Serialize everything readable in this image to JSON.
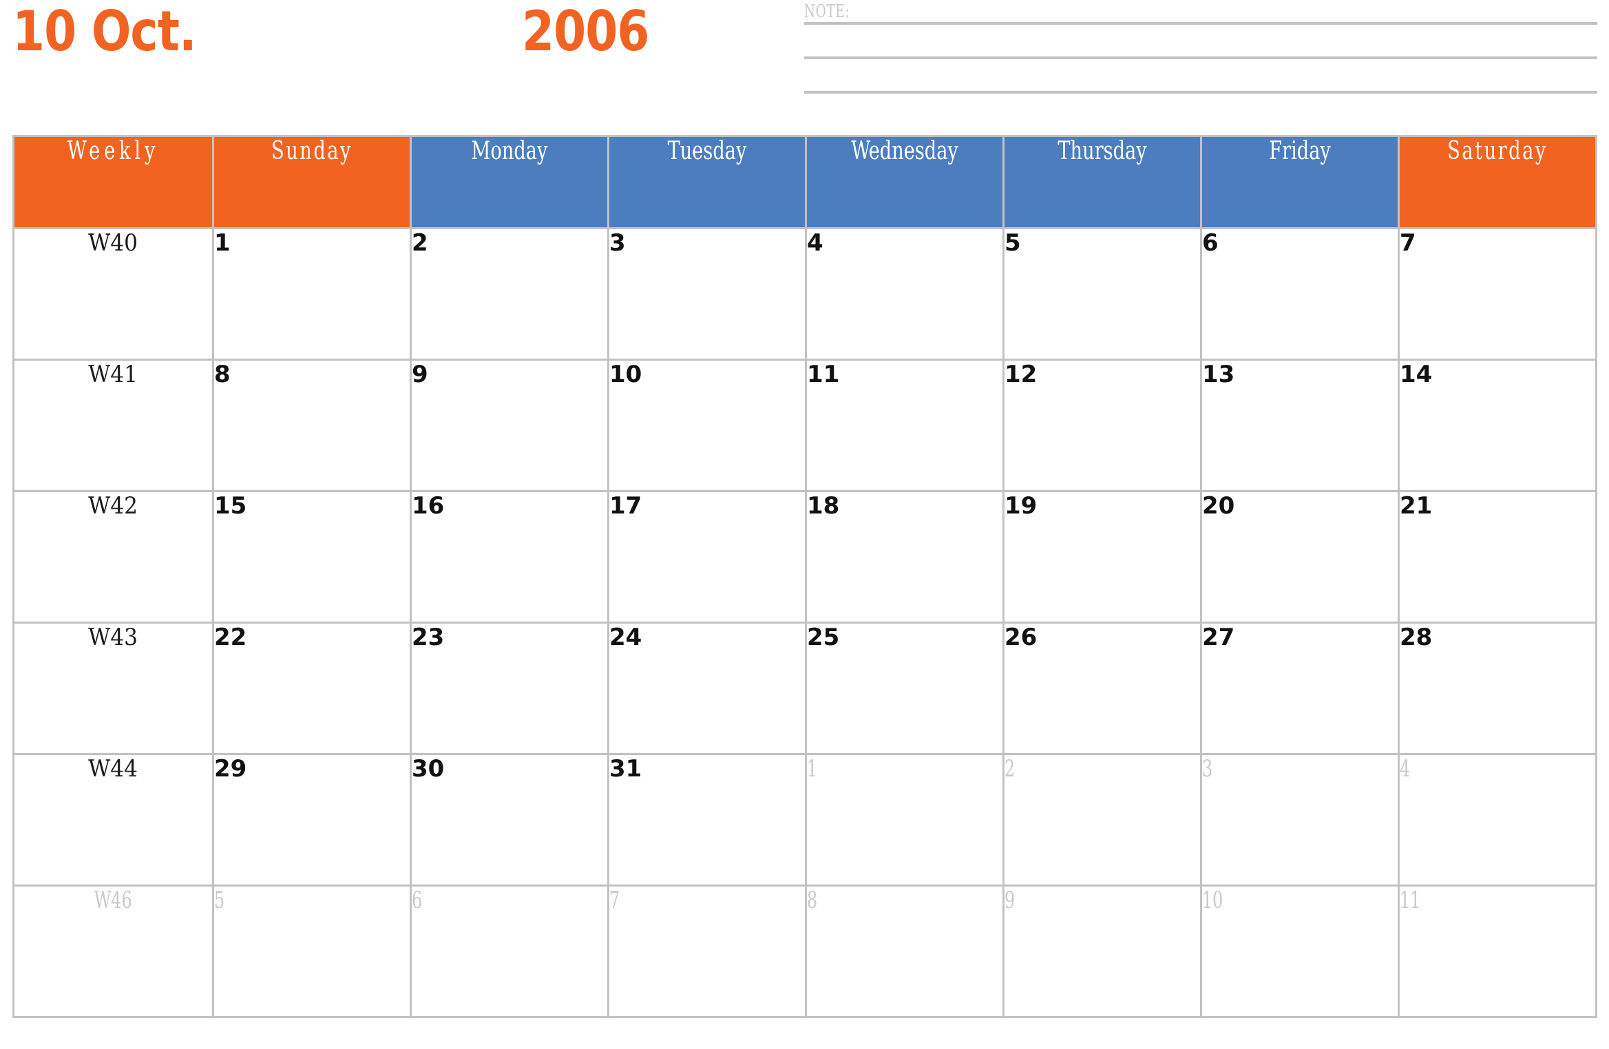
{
  "header": {
    "month_label": "10 Oct.",
    "year_label": "2006",
    "accent_color": "#F26322",
    "weekday_color": "#4C7EBF",
    "muted_color": "#C9C9C9",
    "border_color": "#C2C2C2"
  },
  "note": {
    "label": "NOTE:",
    "line_count": 3
  },
  "calendar": {
    "columns": [
      {
        "label": "Weekly",
        "style": "weekend"
      },
      {
        "label": "Sunday",
        "style": "weekend"
      },
      {
        "label": "Monday",
        "style": "weekday"
      },
      {
        "label": "Tuesday",
        "style": "weekday"
      },
      {
        "label": "Wednesday",
        "style": "weekday"
      },
      {
        "label": "Thursday",
        "style": "weekday"
      },
      {
        "label": "Friday",
        "style": "weekday"
      },
      {
        "label": "Saturday",
        "style": "weekend"
      }
    ],
    "rows": [
      {
        "week": "W40",
        "week_muted": false,
        "days": [
          {
            "num": "1",
            "muted": false
          },
          {
            "num": "2",
            "muted": false
          },
          {
            "num": "3",
            "muted": false
          },
          {
            "num": "4",
            "muted": false
          },
          {
            "num": "5",
            "muted": false
          },
          {
            "num": "6",
            "muted": false
          },
          {
            "num": "7",
            "muted": false
          }
        ]
      },
      {
        "week": "W41",
        "week_muted": false,
        "days": [
          {
            "num": "8",
            "muted": false
          },
          {
            "num": "9",
            "muted": false
          },
          {
            "num": "10",
            "muted": false
          },
          {
            "num": "11",
            "muted": false
          },
          {
            "num": "12",
            "muted": false
          },
          {
            "num": "13",
            "muted": false
          },
          {
            "num": "14",
            "muted": false
          }
        ]
      },
      {
        "week": "W42",
        "week_muted": false,
        "days": [
          {
            "num": "15",
            "muted": false
          },
          {
            "num": "16",
            "muted": false
          },
          {
            "num": "17",
            "muted": false
          },
          {
            "num": "18",
            "muted": false
          },
          {
            "num": "19",
            "muted": false
          },
          {
            "num": "20",
            "muted": false
          },
          {
            "num": "21",
            "muted": false
          }
        ]
      },
      {
        "week": "W43",
        "week_muted": false,
        "days": [
          {
            "num": "22",
            "muted": false
          },
          {
            "num": "23",
            "muted": false
          },
          {
            "num": "24",
            "muted": false
          },
          {
            "num": "25",
            "muted": false
          },
          {
            "num": "26",
            "muted": false
          },
          {
            "num": "27",
            "muted": false
          },
          {
            "num": "28",
            "muted": false
          }
        ]
      },
      {
        "week": "W44",
        "week_muted": false,
        "days": [
          {
            "num": "29",
            "muted": false
          },
          {
            "num": "30",
            "muted": false
          },
          {
            "num": "31",
            "muted": false
          },
          {
            "num": "1",
            "muted": true
          },
          {
            "num": "2",
            "muted": true
          },
          {
            "num": "3",
            "muted": true
          },
          {
            "num": "4",
            "muted": true
          }
        ]
      },
      {
        "week": "W46",
        "week_muted": true,
        "days": [
          {
            "num": "5",
            "muted": true
          },
          {
            "num": "6",
            "muted": true
          },
          {
            "num": "7",
            "muted": true
          },
          {
            "num": "8",
            "muted": true
          },
          {
            "num": "9",
            "muted": true
          },
          {
            "num": "10",
            "muted": true
          },
          {
            "num": "11",
            "muted": true
          }
        ]
      }
    ]
  }
}
